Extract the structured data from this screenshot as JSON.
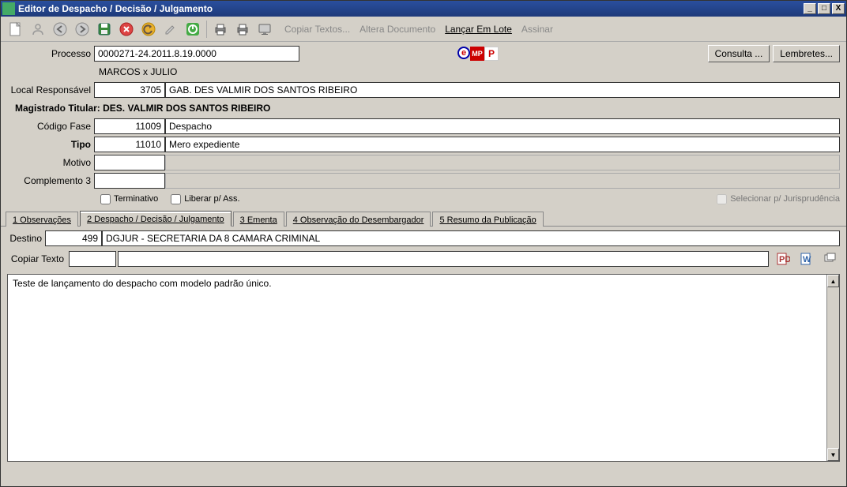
{
  "title": "Editor de Despacho / Decisão / Julgamento",
  "toolbar_links": {
    "copiar": "Copiar Textos...",
    "altera": "Altera Documento",
    "lancar": "Lançar Em Lote",
    "assinar": "Assinar"
  },
  "buttons": {
    "consulta": "Consulta ...",
    "lembretes": "Lembretes..."
  },
  "labels": {
    "processo": "Processo",
    "local_resp": "Local Responsável",
    "magistrado_titular": "Magistrado Titular: DES. VALMIR DOS SANTOS RIBEIRO",
    "codigo_fase": "Código Fase",
    "tipo": "Tipo",
    "motivo": "Motivo",
    "complemento3": "Complemento 3",
    "terminativo": "Terminativo",
    "liberar": "Liberar p/ Ass.",
    "selecionar_jur": "Selecionar p/ Jurisprudência",
    "destino": "Destino",
    "copiar_texto": "Copiar Texto"
  },
  "fields": {
    "processo": "0000271-24.2011.8.19.0000",
    "partes": "MARCOS x JULIO",
    "local_resp_cod": "3705",
    "local_resp_desc": "GAB. DES VALMIR DOS SANTOS RIBEIRO",
    "codigo_fase": "11009",
    "codigo_fase_desc": "Despacho",
    "tipo": "11010",
    "tipo_desc": "Mero expediente",
    "motivo": "",
    "motivo_desc": "",
    "complemento3": "",
    "complemento3_desc": "",
    "destino_cod": "499",
    "destino_desc": "DGJUR - SECRETARIA DA 8 CAMARA CRIMINAL"
  },
  "tabs": {
    "t1": "1 Observações",
    "t2": "2 Despacho / Decisão / Julgamento",
    "t3": "3 Ementa",
    "t4": "4 Observação do Desembargador",
    "t5": "5 Resumo da Publicação"
  },
  "editor": {
    "text": "Teste de lançamento do despacho com modelo padrão único."
  },
  "badges": {
    "e": "e",
    "mp": "MP",
    "p": "P"
  }
}
